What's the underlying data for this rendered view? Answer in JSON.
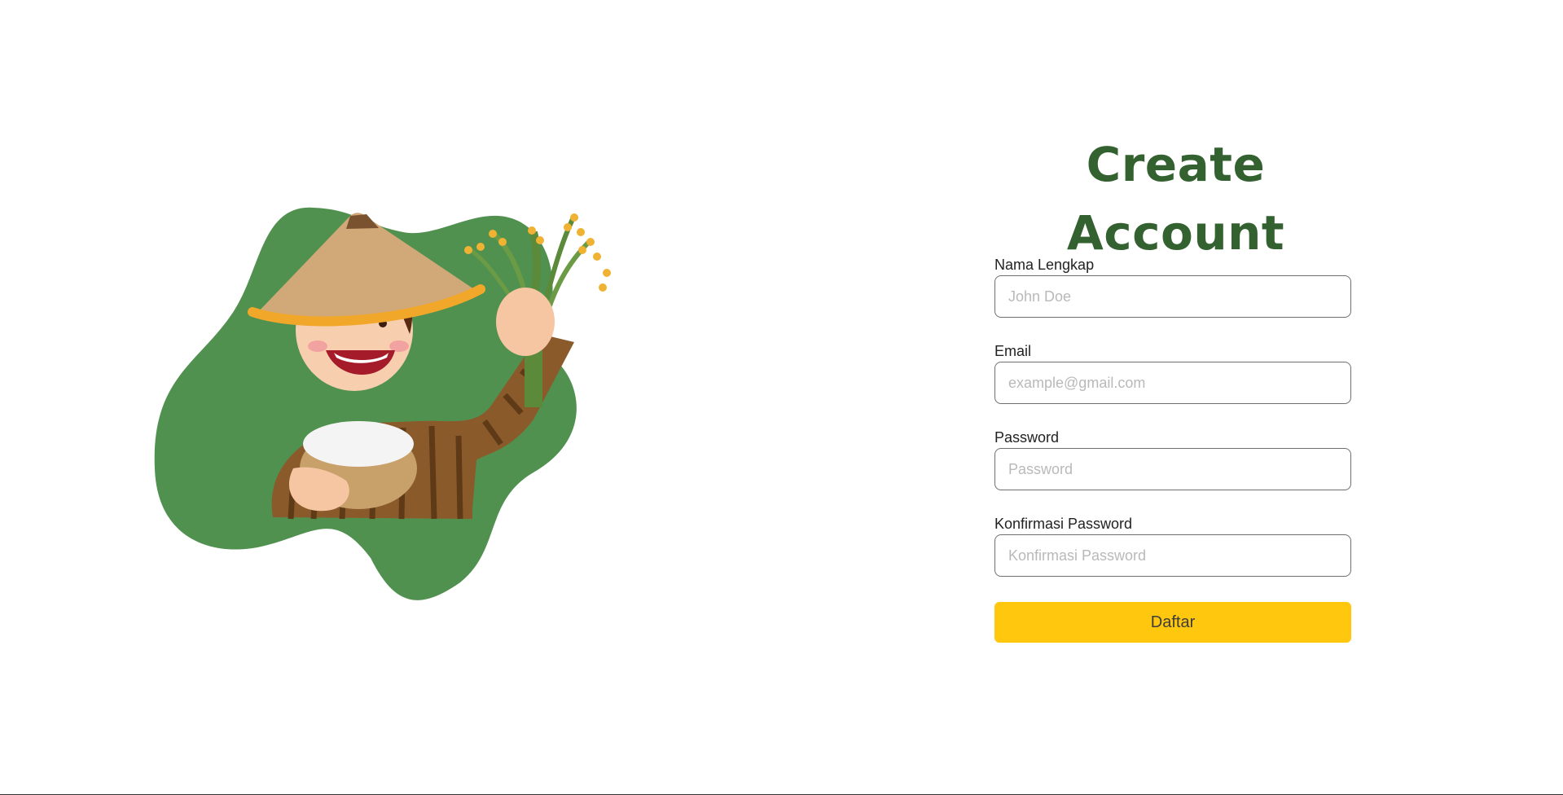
{
  "title": "Create Account",
  "form": {
    "fields": [
      {
        "label": "Nama Lengkap",
        "placeholder": "John Doe",
        "type": "text"
      },
      {
        "label": "Email",
        "placeholder": "example@gmail.com",
        "type": "email"
      },
      {
        "label": "Password",
        "placeholder": "Password",
        "type": "password"
      },
      {
        "label": "Konfirmasi Password",
        "placeholder": "Konfirmasi Password",
        "type": "password"
      }
    ],
    "submit_label": "Daftar"
  },
  "illustration": {
    "subject": "farmer-holding-rice-illustration"
  },
  "colors": {
    "title": "#33612f",
    "blob": "#519150",
    "button": "#ffc80f",
    "input_border": "#6f6f6f"
  }
}
